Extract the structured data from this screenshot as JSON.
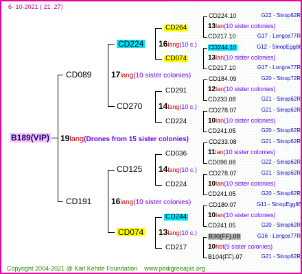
{
  "header": {
    "date": "6- 10-2021 (  21:  27)"
  },
  "footer": {
    "copyright": "Copyright 2004-2021 @ Karl Kehrle Foundation",
    "url": "www.pedigreeapis.org"
  },
  "root": {
    "id": "B189(VIP)",
    "count": "19",
    "lang": "lang",
    "desc": "(Drones from 15 sister colonies)"
  },
  "g1": [
    {
      "id": "CD089",
      "count": "17",
      "lang": "lang",
      "desc": "(10 sister colonies)"
    },
    {
      "id": "CD191",
      "count": "16",
      "lang": "lang",
      "desc": "(10 sister colonies)"
    }
  ],
  "g2": [
    {
      "id": "CD224",
      "count": "16",
      "lang": "lang",
      "desc": "(10 c.)"
    },
    {
      "id": "CD270",
      "count": "14",
      "lang": "lang",
      "desc": "(10 c.)"
    },
    {
      "id": "CD125",
      "count": "14",
      "lang": "lang",
      "desc": "(10 c.)"
    },
    {
      "id": "CD074",
      "count": "13",
      "lang": "lang",
      "desc": "(10 c.)"
    }
  ],
  "g3": [
    {
      "id": "CD264"
    },
    {
      "id": "CD074"
    },
    {
      "id": "CD291"
    },
    {
      "id": "CD224"
    },
    {
      "id": "CD036"
    },
    {
      "id": "CD224"
    },
    {
      "id": "CD244"
    },
    {
      "id": "CD217"
    }
  ],
  "g4": [
    {
      "top": "CD224.10",
      "top_info": "G22 - Sinop62R",
      "count": "13",
      "lang": "lan",
      "desc": "(10 sister colonies)",
      "bot": "CD217.10",
      "bot_info": "G17 - Longos77R"
    },
    {
      "top": "CD244.10",
      "top_info": "G12 - SinopEgg86R",
      "count": "13",
      "lang": "lan",
      "desc": "(10 sister colonies)",
      "bot": "CD217.10",
      "bot_info": "G17 - Longos77R"
    },
    {
      "top": "CD184.09",
      "top_info": "G20 - Sinop72R",
      "count": "12",
      "lang": "lan",
      "desc": "(10 sister colonies)",
      "bot": "CD233.08",
      "bot_info": "G21 - Sinop62R"
    },
    {
      "top": "CD278.07",
      "top_info": "G21 - Sinop62R",
      "count": "10",
      "lang": "lan",
      "desc": "(10 sister colonies)",
      "bot": "CD241.05",
      "bot_info": "G20 - Sinop62R"
    },
    {
      "top": "CD233.08",
      "top_info": "G21 - Sinop62R",
      "count": "11",
      "lang": "lan",
      "desc": "(10 sister colonies)",
      "bot": "CD098.08",
      "bot_info": "G22 - Sinop62R"
    },
    {
      "top": "CD278.07",
      "top_info": "G21 - Sinop62R",
      "count": "10",
      "lang": "lan",
      "desc": "(10 sister colonies)",
      "bot": "CD241.05",
      "bot_info": "G20 - Sinop62R"
    },
    {
      "top": "CD180.07",
      "top_info": "G11 - SinopEgg86R",
      "count": "10",
      "lang": "lan",
      "desc": "(10 sister colonies)",
      "bot": "CD241.05",
      "bot_info": "G20 - Sinop62R"
    },
    {
      "top": "B30(FF).08",
      "top_info": "G16 - Longos77R",
      "count": "10",
      "lang": "hbt",
      "desc": "(9 sister colonies)",
      "bot": "B104(FF).07",
      "bot_info": "G21 - Sinop62R"
    }
  ]
}
